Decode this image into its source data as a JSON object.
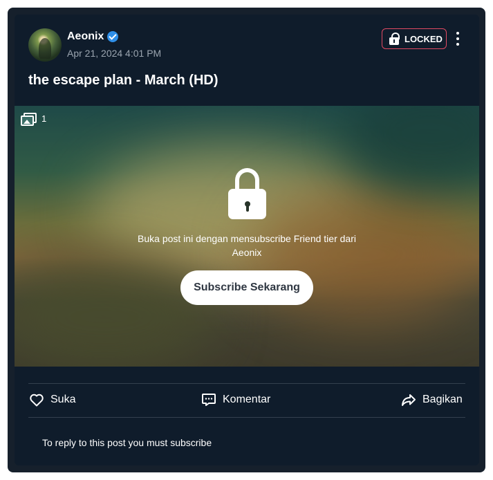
{
  "post": {
    "author": "Aeonix",
    "timestamp": "Apr 21, 2024 4:01 PM",
    "locked_label": "LOCKED",
    "title": "the escape plan - March (HD)",
    "media_count": "1",
    "unlock_message": "Buka post ini dengan mensubscribe Friend tier dari Aeonix",
    "subscribe_button": "Subscribe Sekarang"
  },
  "actions": {
    "like": "Suka",
    "comment": "Komentar",
    "share": "Bagikan"
  },
  "reply_notice": "To reply to this post you must subscribe",
  "colors": {
    "card_background": "#0f1c2b",
    "locked_border": "#e24a63",
    "verified_badge": "#2f8fe8"
  },
  "icons": [
    "verified-icon",
    "lock-icon",
    "more-vertical-icon",
    "image-icon",
    "heart-icon",
    "comment-icon",
    "share-icon"
  ]
}
